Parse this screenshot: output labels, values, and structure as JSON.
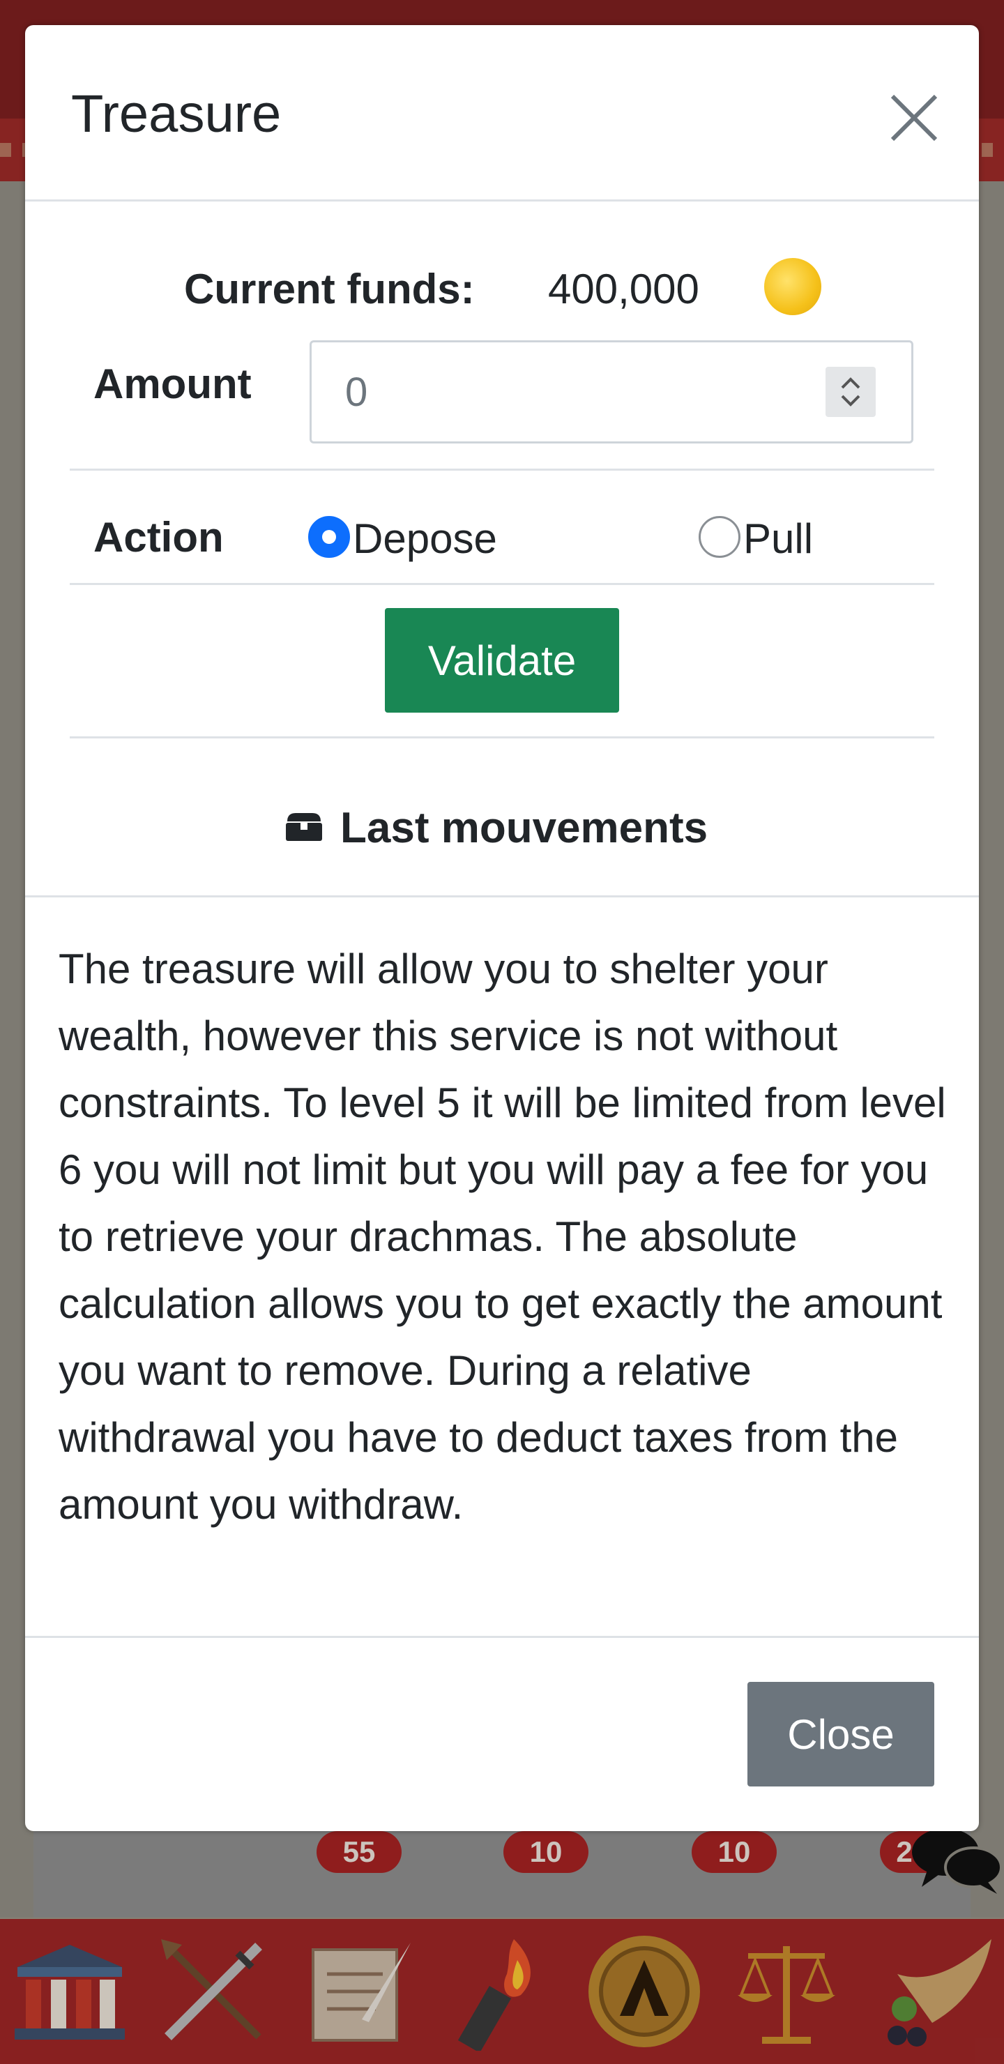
{
  "modal": {
    "title": "Treasure",
    "close_icon": "close-icon",
    "funds_label": "Current funds:",
    "funds_value": "400,000",
    "coin_icon": "gold-coin-icon",
    "amount_label": "Amount",
    "amount_value": "0",
    "action_label": "Action",
    "options": [
      {
        "label": "Depose",
        "selected": true
      },
      {
        "label": "Pull",
        "selected": false
      }
    ],
    "validate_label": "Validate",
    "last_movements_icon": "treasure-chest-icon",
    "last_movements_label": "Last mouvements",
    "description": "The treasure will allow you to shelter your wealth, however this service is not without constraints. To level 5 it will be limited from level 6 you will not limit but you will pay a fee for you to retrieve your drachmas. The absolute calculation allows you to get exactly the amount you want to remove. During a relative withdrawal you have to deduct taxes from the amount you withdraw.",
    "close_label": "Close"
  },
  "background": {
    "badges": [
      "55",
      "10",
      "10",
      "2"
    ],
    "nav_icons": [
      "temple-icon",
      "crossed-swords-icon",
      "scroll-quill-icon",
      "torch-icon",
      "spartan-shield-icon",
      "scales-icon",
      "cornucopia-icon"
    ],
    "chat_icon": "chat-bubbles-icon"
  },
  "colors": {
    "primary": "#0d6efd",
    "success": "#198754",
    "secondary": "#6c757d",
    "bar_red": "#9b2525"
  }
}
